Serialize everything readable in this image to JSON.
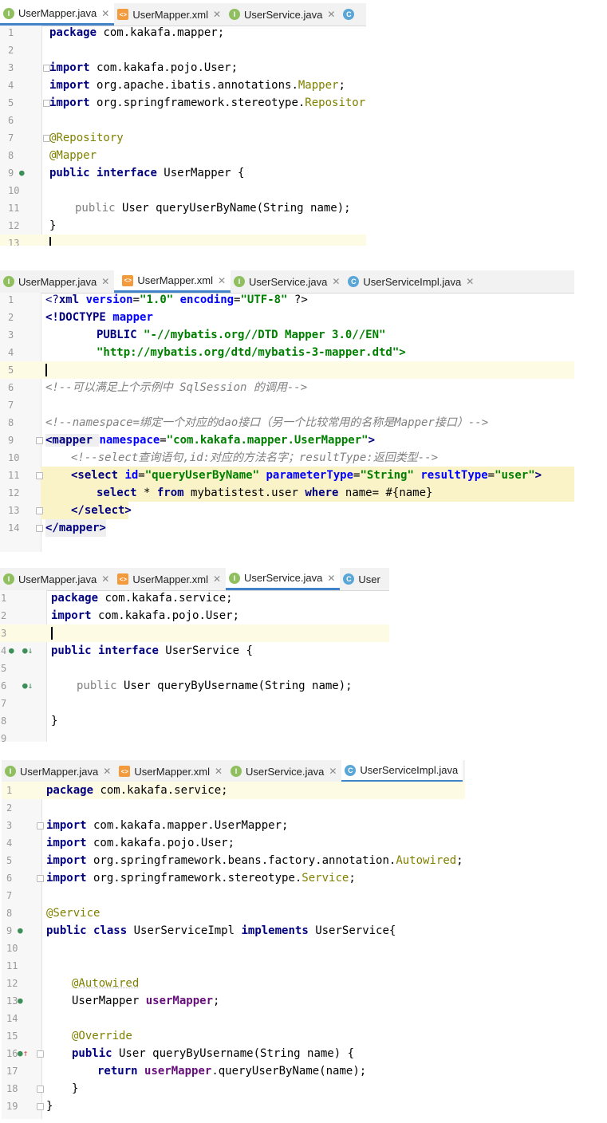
{
  "panel1": {
    "tabs": [
      {
        "label": "UserMapper.java",
        "icon": "I",
        "active": true
      },
      {
        "label": "UserMapper.xml",
        "icon": "xml",
        "active": false
      },
      {
        "label": "UserService.java",
        "icon": "I",
        "active": false
      }
    ],
    "lines": [
      "1",
      "2",
      "3",
      "4",
      "5",
      "6",
      "7",
      "8",
      "9",
      "10",
      "11",
      "12",
      "13"
    ],
    "code": {
      "l1_kw": "package",
      "l1_rest": " com.kakafa.mapper;",
      "l3_kw": "import",
      "l3_rest": " com.kakafa.pojo.User;",
      "l4_kw": "import",
      "l4_rest": " org.apache.ibatis.annotations.",
      "l4_ann": "Mapper",
      "l4_end": ";",
      "l5_kw": "import",
      "l5_rest": " org.springframework.stereotype.",
      "l5_ann": "Repository",
      "l5_end": ";",
      "l7": "@Repository",
      "l8": "@Mapper",
      "l9_kw1": "public",
      "l9_kw2": "interface",
      "l9_rest": " UserMapper {",
      "l11_kw": "public",
      "l11_rest": " User queryUserByName(String name);",
      "l12": "}"
    }
  },
  "panel2": {
    "tabs": [
      {
        "label": "UserMapper.java",
        "icon": "I",
        "active": false
      },
      {
        "label": "UserMapper.xml",
        "icon": "xml",
        "active": true
      },
      {
        "label": "UserService.java",
        "icon": "I",
        "active": false
      },
      {
        "label": "UserServiceImpl.java",
        "icon": "C",
        "active": false
      }
    ],
    "lines": [
      "1",
      "2",
      "3",
      "4",
      "5",
      "6",
      "7",
      "8",
      "9",
      "10",
      "11",
      "12",
      "13",
      "14"
    ],
    "code": {
      "l1_a": "<?",
      "l1_b": "xml ",
      "l1_c": "version",
      "l1_d": "=",
      "l1_e": "\"1.0\"",
      "l1_f": " encoding",
      "l1_g": "=",
      "l1_h": "\"UTF-8\"",
      "l1_i": " ?>",
      "l2_a": "<!DOCTYPE ",
      "l2_b": "mapper",
      "l3_a": "PUBLIC ",
      "l3_b": "\"-//mybatis.org//DTD Mapper 3.0//EN\"",
      "l4": "\"http://mybatis.org/dtd/mybatis-3-mapper.dtd\">",
      "l6": "<!--可以满足上个示例中 SqlSession 的调用-->",
      "l8": "<!--namespace=绑定一个对应的dao接口（另一个比较常用的名称是Mapper接口）-->",
      "l9_a": "<mapper ",
      "l9_b": "namespace",
      "l9_c": "=",
      "l9_d": "\"com.kakafa.mapper.UserMapper\"",
      "l9_e": ">",
      "l10": "<!--select查询语句,id:对应的方法名字；resultType:返回类型-->",
      "l11_a": "<select ",
      "l11_b": "id",
      "l11_c": "=",
      "l11_d": "\"queryUserByName\"",
      "l11_e": " parameterType",
      "l11_f": "=",
      "l11_g": "\"String\"",
      "l11_h": " resultType",
      "l11_i": "=",
      "l11_j": "\"user\"",
      "l11_k": ">",
      "l12_a": "select",
      "l12_b": " * ",
      "l12_c": "from",
      "l12_d": " mybatistest.user ",
      "l12_e": "where",
      "l12_f": " name= #{name}",
      "l13": "</select>",
      "l14": "</mapper>"
    }
  },
  "panel3": {
    "tabs": [
      {
        "label": "UserMapper.java",
        "icon": "I",
        "active": false
      },
      {
        "label": "UserMapper.xml",
        "icon": "xml",
        "active": false
      },
      {
        "label": "UserService.java",
        "icon": "I",
        "active": true
      },
      {
        "label": "User",
        "icon": "C",
        "active": false
      }
    ],
    "lines": [
      "1",
      "2",
      "3",
      "4",
      "5",
      "6",
      "7",
      "8",
      "9"
    ],
    "code": {
      "l1_kw": "package",
      "l1_rest": " com.kakafa.service;",
      "l2_kw": "import",
      "l2_rest": " com.kakafa.pojo.User;",
      "l4_kw1": "public",
      "l4_kw2": "interface",
      "l4_rest": " UserService {",
      "l6_kw": "public",
      "l6_rest": " User queryByUsername(String name);",
      "l8": "}"
    }
  },
  "panel4": {
    "tabs": [
      {
        "label": "UserMapper.java",
        "icon": "I",
        "active": false
      },
      {
        "label": "UserMapper.xml",
        "icon": "xml",
        "active": false
      },
      {
        "label": "UserService.java",
        "icon": "I",
        "active": false
      },
      {
        "label": "UserServiceImpl.java",
        "icon": "C",
        "active": true
      }
    ],
    "lines": [
      "1",
      "2",
      "3",
      "4",
      "5",
      "6",
      "7",
      "8",
      "9",
      "10",
      "11",
      "12",
      "13",
      "14",
      "15",
      "16",
      "17",
      "18",
      "19"
    ],
    "code": {
      "l1_kw": "package",
      "l1_rest": " com.kakafa.service;",
      "l3_kw": "import",
      "l3_rest": " com.kakafa.mapper.UserMapper;",
      "l4_kw": "import",
      "l4_rest": " com.kakafa.pojo.User;",
      "l5_kw": "import",
      "l5_rest": " org.springframework.beans.factory.annotation.",
      "l5_ann": "Autowired",
      "l5_end": ";",
      "l6_kw": "import",
      "l6_rest": " org.springframework.stereotype.",
      "l6_ann": "Service",
      "l6_end": ";",
      "l8": "@Service",
      "l9_kw1": "public",
      "l9_kw2": "class",
      "l9_mid": " UserServiceImpl ",
      "l9_kw3": "implements",
      "l9_rest": " UserService{",
      "l12": "@Autowired",
      "l13_a": "UserMapper ",
      "l13_b": "userMapper",
      "l13_c": ";",
      "l15": "@Override",
      "l16_kw": "public",
      "l16_rest": " User queryByUsername(String name) {",
      "l17_kw": "return ",
      "l17_fld": "userMapper",
      "l17_rest": ".queryUserByName(name);",
      "l18": "}",
      "l19": "}"
    }
  },
  "colors": {
    "keyword": "#000080",
    "annotation": "#808000",
    "string": "#008000",
    "comment": "#808080",
    "field": "#660e7a",
    "active_tab_underline": "#4083c9",
    "current_line": "#fefbe4"
  }
}
